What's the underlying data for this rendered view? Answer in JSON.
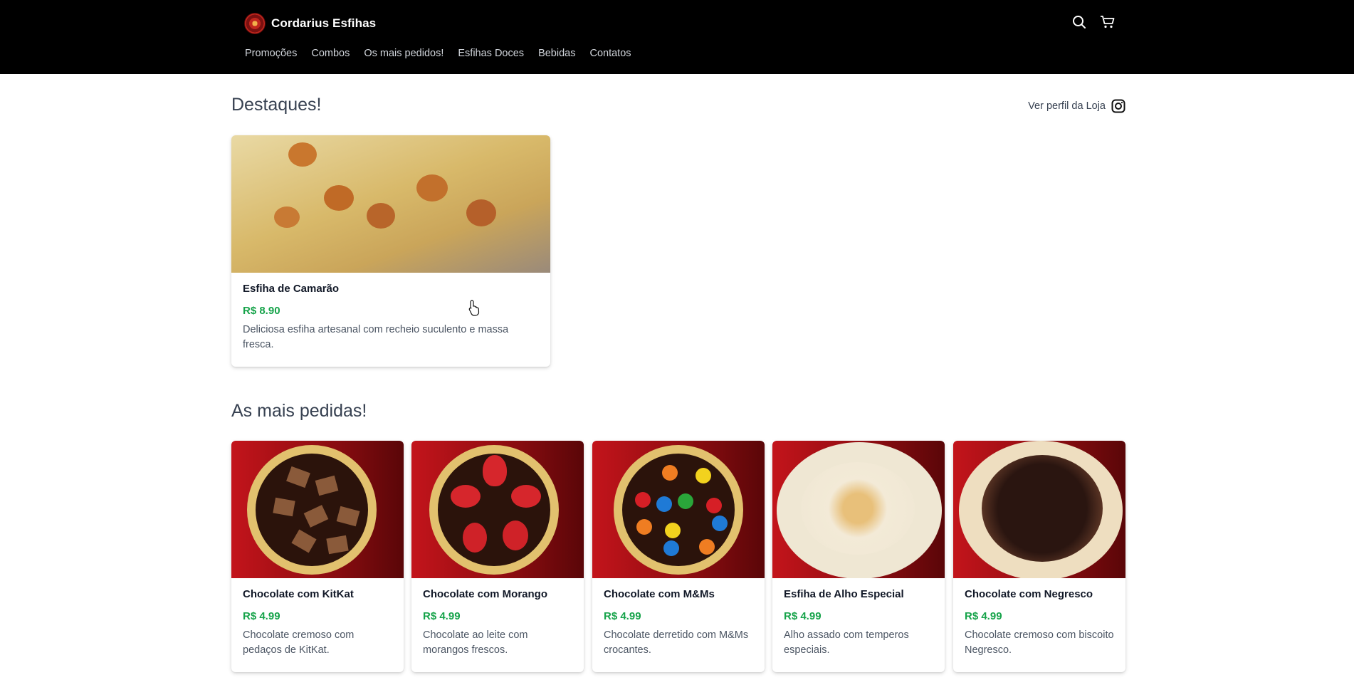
{
  "header": {
    "brand_name": "Cordarius Esfihas",
    "icons": {
      "search": "search-icon",
      "cart": "cart-icon"
    },
    "nav": [
      "Promoções",
      "Combos",
      "Os mais pedidos!",
      "Esfihas Doces",
      "Bebidas",
      "Contatos"
    ]
  },
  "highlights": {
    "title": "Destaques!",
    "store_link": "Ver perfil da Loja",
    "store_icon": "instagram-icon",
    "items": [
      {
        "name": "Esfiha de Camarão",
        "price": "R$ 8.90",
        "description": "Deliciosa esfiha artesanal com recheio suculento e massa fresca."
      }
    ]
  },
  "popular": {
    "title": "As mais pedidas!",
    "items": [
      {
        "name": "Chocolate com KitKat",
        "price": "R$ 4.99",
        "description": "Chocolate cremoso com pedaços de KitKat."
      },
      {
        "name": "Chocolate com Morango",
        "price": "R$ 4.99",
        "description": "Chocolate ao leite com morangos frescos."
      },
      {
        "name": "Chocolate com M&Ms",
        "price": "R$ 4.99",
        "description": "Chocolate derretido com M&Ms crocantes."
      },
      {
        "name": "Esfiha de Alho Especial",
        "price": "R$ 4.99",
        "description": "Alho assado com temperos especiais."
      },
      {
        "name": "Chocolate com Negresco",
        "price": "R$ 4.99",
        "description": "Chocolate cremoso com biscoito Negresco."
      }
    ]
  },
  "colors": {
    "header_bg": "#000000",
    "price": "#16a34a",
    "card_bg_red": "#c3141b"
  }
}
